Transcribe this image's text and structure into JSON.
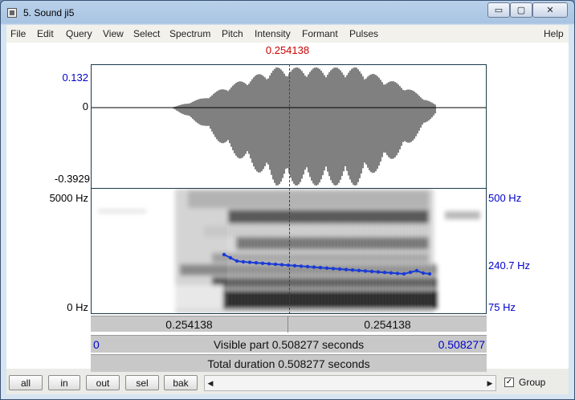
{
  "window": {
    "title": "5. Sound ji5",
    "minimize": "▭",
    "maximize": "▢",
    "close": "✕"
  },
  "menu": [
    "File",
    "Edit",
    "Query",
    "View",
    "Select",
    "Spectrum",
    "Pitch",
    "Intensity",
    "Formant",
    "Pulses",
    "Help"
  ],
  "cursor_time": "0.254138",
  "waveform": {
    "max_label": "0.132",
    "zero_label": "0",
    "min_label": "-0.3929"
  },
  "spectrogram": {
    "freq_top": "5000 Hz",
    "freq_bottom": "0 Hz",
    "pitch_top": "500 Hz",
    "pitch_mid": "240.7 Hz",
    "pitch_bottom": "75 Hz",
    "pitch_color": "#1a3bd6"
  },
  "timebar": {
    "left": "0.254138",
    "right": "0.254138"
  },
  "visible": {
    "start": "0",
    "text": "Visible part 0.508277 seconds",
    "end": "0.508277"
  },
  "total": {
    "text": "Total duration 0.508277 seconds"
  },
  "buttons": [
    "all",
    "in",
    "out",
    "sel",
    "bak"
  ],
  "group": {
    "label": "Group",
    "checked": true
  }
}
